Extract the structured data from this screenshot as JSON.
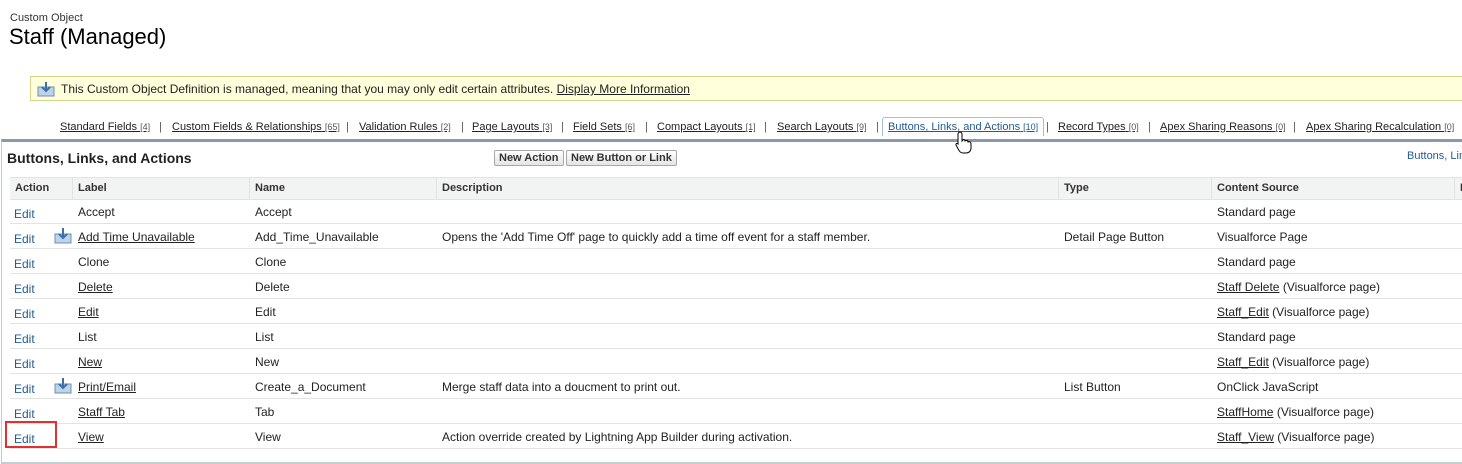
{
  "header": {
    "object_type": "Custom Object",
    "object_name": "Staff (Managed)"
  },
  "notice": {
    "text": "This Custom Object Definition is managed, meaning that you may only edit certain attributes.",
    "link": "Display More Information"
  },
  "tabs": [
    {
      "label": "Standard Fields",
      "count": "[4]"
    },
    {
      "label": "Custom Fields & Relationships",
      "count": "[65]"
    },
    {
      "label": "Validation Rules",
      "count": "[2]"
    },
    {
      "label": "Page Layouts",
      "count": "[3]"
    },
    {
      "label": "Field Sets",
      "count": "[6]"
    },
    {
      "label": "Compact Layouts",
      "count": "[1]"
    },
    {
      "label": "Search Layouts",
      "count": "[9]"
    },
    {
      "label": "Buttons, Links, and Actions",
      "count": "[10]",
      "active": true
    },
    {
      "label": "Record Types",
      "count": "[0]"
    },
    {
      "label": "Apex Sharing Reasons",
      "count": "[0]"
    },
    {
      "label": "Apex Sharing Recalculation",
      "count": "[0]"
    }
  ],
  "panel": {
    "title": "Buttons, Links, and Actions",
    "new_action": "New Action",
    "new_button": "New Button or Link",
    "help_link": "Buttons, Lin"
  },
  "columns": [
    "Action",
    "Label",
    "Name",
    "Description",
    "Type",
    "Content Source",
    "I"
  ],
  "rows": [
    {
      "action": "Edit",
      "label": "Accept",
      "label_link": false,
      "managed": false,
      "name": "Accept",
      "description": "",
      "type": "",
      "source_link": "",
      "source": "Standard page"
    },
    {
      "action": "Edit",
      "label": "Add Time Unavailable",
      "label_link": true,
      "managed": true,
      "name": "Add_Time_Unavailable",
      "description": "Opens the 'Add Time Off' page to quickly add a time off event for a staff member.",
      "type": "Detail Page Button",
      "source_link": "",
      "source": "Visualforce Page"
    },
    {
      "action": "Edit",
      "label": "Clone",
      "label_link": false,
      "managed": false,
      "name": "Clone",
      "description": "",
      "type": "",
      "source_link": "",
      "source": "Standard page"
    },
    {
      "action": "Edit",
      "label": "Delete",
      "label_link": true,
      "managed": false,
      "name": "Delete",
      "description": "",
      "type": "",
      "source_link": "Staff Delete",
      "source": " (Visualforce page)"
    },
    {
      "action": "Edit",
      "label": "Edit",
      "label_link": true,
      "managed": false,
      "name": "Edit",
      "description": "",
      "type": "",
      "source_link": "Staff_Edit",
      "source": " (Visualforce page)"
    },
    {
      "action": "Edit",
      "label": "List",
      "label_link": false,
      "managed": false,
      "name": "List",
      "description": "",
      "type": "",
      "source_link": "",
      "source": "Standard page"
    },
    {
      "action": "Edit",
      "label": "New",
      "label_link": true,
      "managed": false,
      "name": "New",
      "description": "",
      "type": "",
      "source_link": "Staff_Edit",
      "source": " (Visualforce page)"
    },
    {
      "action": "Edit",
      "label": "Print/Email",
      "label_link": true,
      "managed": true,
      "name": "Create_a_Document",
      "description": "Merge staff data into a doucment to print out.",
      "type": "List Button",
      "source_link": "",
      "source": "OnClick JavaScript"
    },
    {
      "action": "Edit",
      "label": "Staff Tab",
      "label_link": true,
      "managed": false,
      "name": "Tab",
      "description": "",
      "type": "",
      "source_link": "StaffHome",
      "source": " (Visualforce page)"
    },
    {
      "action": "Edit",
      "label": "View",
      "label_link": true,
      "managed": false,
      "name": "View",
      "description": "Action override created by Lightning App Builder during activation.",
      "type": "",
      "source_link": "Staff_View",
      "source": " (Visualforce page)"
    }
  ],
  "colors": {
    "link": "#1f5b96",
    "highlight": "#e03030",
    "notice_bg": "#ffffdc"
  },
  "icons": {
    "package": "managed-package-icon",
    "cursor": "hand-pointer-icon"
  }
}
